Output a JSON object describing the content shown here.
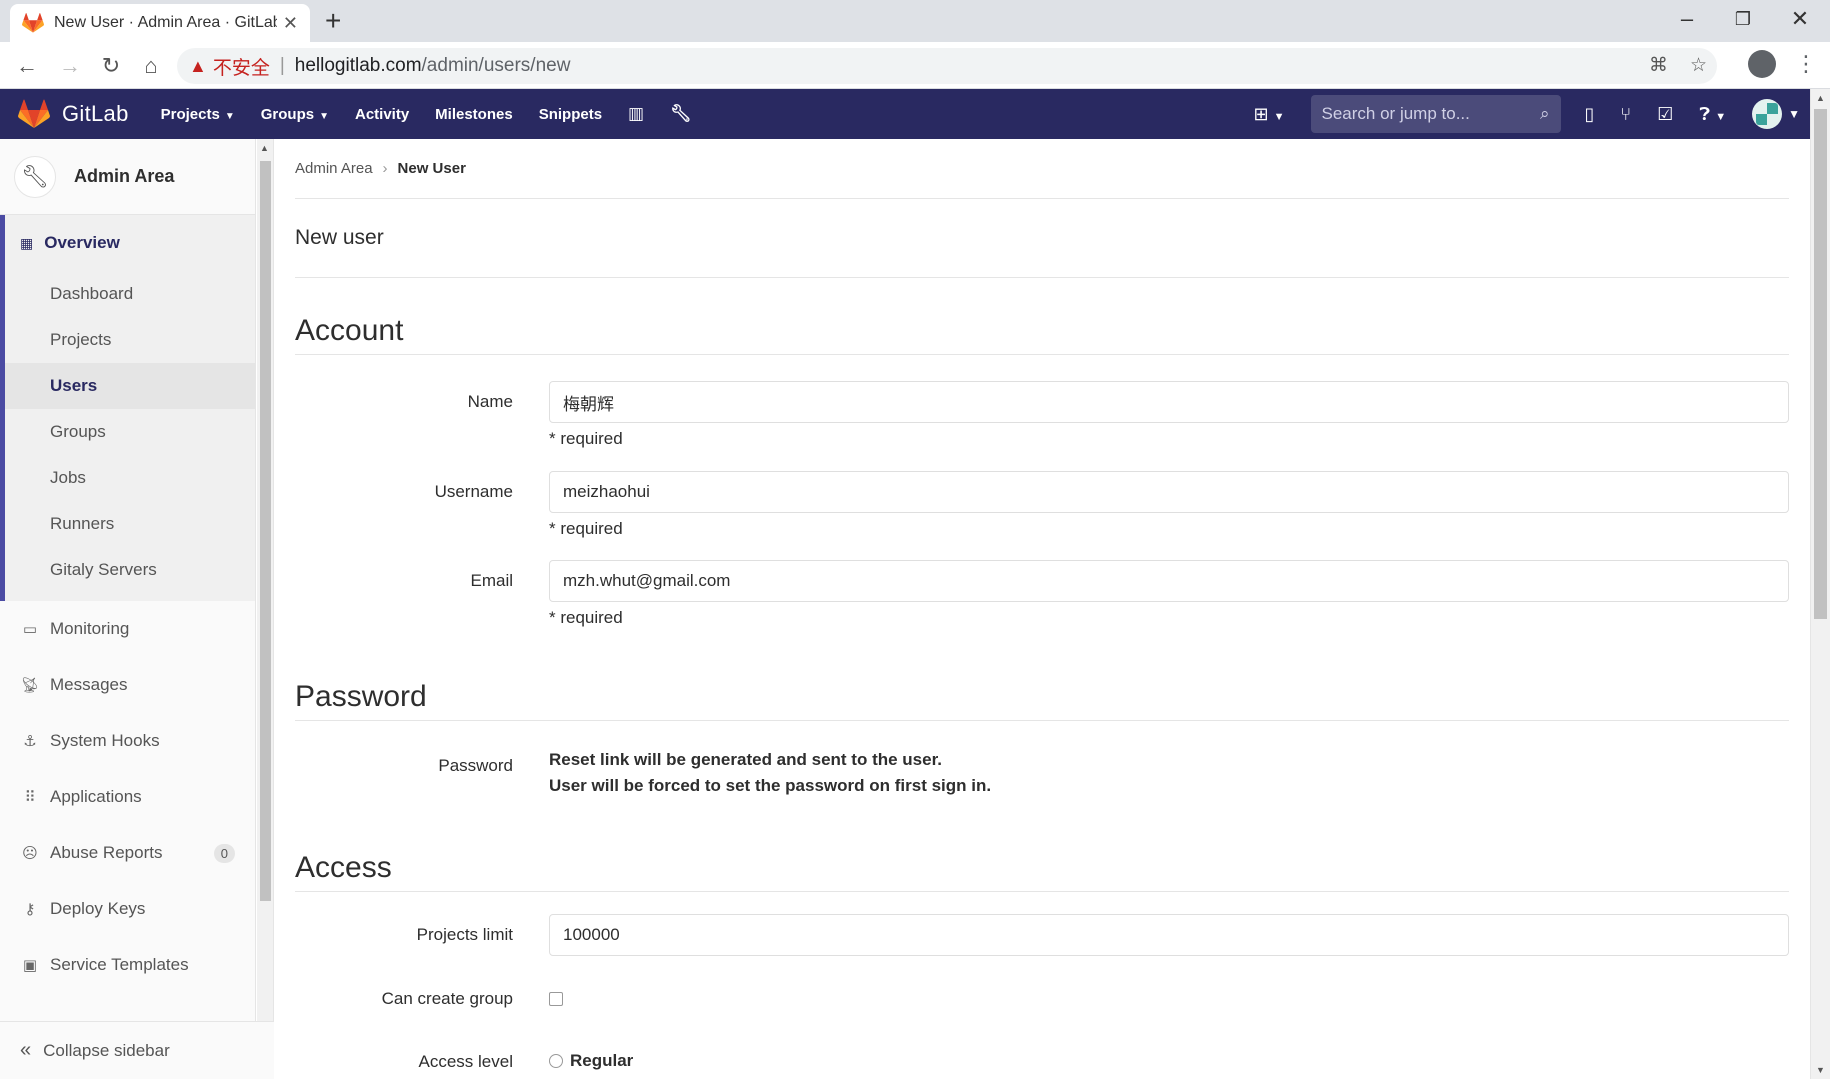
{
  "browser": {
    "tab_title": "New User · Admin Area · GitLab",
    "tab_close": "✕",
    "new_tab": "+",
    "insecure_label": "不安全",
    "url_host": "hellogitlab.com",
    "url_path": "/admin/users/new"
  },
  "header": {
    "brand": "GitLab",
    "nav": [
      "Projects",
      "Groups",
      "Activity",
      "Milestones",
      "Snippets"
    ],
    "search_placeholder": "Search or jump to..."
  },
  "sidebar": {
    "context_title": "Admin Area",
    "overview_label": "Overview",
    "overview_items": [
      "Dashboard",
      "Projects",
      "Users",
      "Groups",
      "Jobs",
      "Runners",
      "Gitaly Servers"
    ],
    "items": [
      {
        "label": "Monitoring",
        "icon": "monitor-icon"
      },
      {
        "label": "Messages",
        "icon": "broadcast-icon"
      },
      {
        "label": "System Hooks",
        "icon": "hook-icon"
      },
      {
        "label": "Applications",
        "icon": "apps-icon"
      },
      {
        "label": "Abuse Reports",
        "icon": "abuse-icon",
        "badge": "0"
      },
      {
        "label": "Deploy Keys",
        "icon": "key-icon"
      },
      {
        "label": "Service Templates",
        "icon": "template-icon"
      }
    ],
    "collapse_label": "Collapse sidebar"
  },
  "breadcrumb": {
    "parent": "Admin Area",
    "current": "New User"
  },
  "page_title": "New user",
  "account": {
    "title": "Account",
    "name_label": "Name",
    "name_value": "梅朝辉",
    "username_label": "Username",
    "username_value": "meizhaohui",
    "email_label": "Email",
    "email_value": "mzh.whut@gmail.com",
    "required_hint": "* required"
  },
  "password": {
    "title": "Password",
    "label": "Password",
    "line1": "Reset link will be generated and sent to the user.",
    "line2": "User will be forced to set the password on first sign in."
  },
  "access": {
    "title": "Access",
    "projects_limit_label": "Projects limit",
    "projects_limit_value": "100000",
    "can_create_group_label": "Can create group",
    "access_level_label": "Access level",
    "regular_label": "Regular"
  },
  "colors": {
    "header_bg": "#292961",
    "sidebar_active": "#4b4ba3",
    "insecure_red": "#c5221f"
  }
}
